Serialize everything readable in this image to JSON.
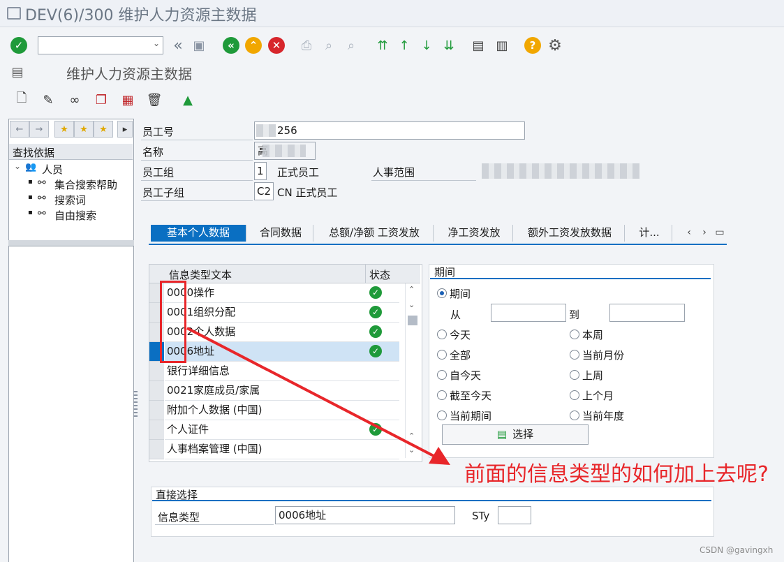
{
  "window": {
    "title": "DEV(6)/300 维护人力资源主数据"
  },
  "app": {
    "title": "维护人力资源主数据"
  },
  "toolbar": {
    "command_value": "",
    "icons": [
      "enter-check-icon",
      "back-double-chevron-icon",
      "save-icon",
      "back-icon",
      "exit-icon",
      "cancel-icon",
      "print-icon",
      "find-icon",
      "find-next-icon",
      "first-page-icon",
      "prev-page-icon",
      "next-page-icon",
      "last-page-icon",
      "new-session-icon",
      "shortcut-icon",
      "help-icon",
      "settings-icon"
    ]
  },
  "apptoolbar": {
    "icons": [
      "create-icon",
      "change-icon",
      "display-icon",
      "copy-icon",
      "delimit-icon",
      "delete-icon",
      "overview-icon"
    ]
  },
  "left": {
    "section_title": "查找依据",
    "tree_root": "人员",
    "tree_items": [
      "集合搜索帮助",
      "搜索词",
      "自由搜索"
    ]
  },
  "header": {
    "emp_no_label": "员工号",
    "emp_no_value": "256",
    "name_label": "名称",
    "name_value": "高",
    "group_label": "员工组",
    "group_code": "1",
    "group_text": "正式员工",
    "area_label": "人事范围",
    "subgroup_label": "员工子组",
    "subgroup_code": "C2",
    "subgroup_text": "CN 正式员工"
  },
  "tabs": [
    "基本个人数据",
    "合同数据",
    "总额/净额 工资发放",
    "净工资发放",
    "额外工资发放数据",
    "计..."
  ],
  "grid": {
    "col_text": "信息类型文本",
    "col_status": "状态",
    "rows": [
      {
        "text": "0000操作",
        "status": true
      },
      {
        "text": "0001组织分配",
        "status": true
      },
      {
        "text": "0002个人数据",
        "status": true
      },
      {
        "text": "0006地址",
        "status": true
      },
      {
        "text": "银行详细信息",
        "status": false
      },
      {
        "text": "0021家庭成员/家属",
        "status": false
      },
      {
        "text": "附加个人数据 (中国)",
        "status": false
      },
      {
        "text": "个人证件",
        "status": true
      },
      {
        "text": "人事档案管理 (中国)",
        "status": false
      }
    ]
  },
  "period": {
    "title": "期间",
    "opt_period": "期间",
    "from": "从",
    "to": "到",
    "options_left": [
      "今天",
      "全部",
      "自今天",
      "截至今天",
      "当前期间"
    ],
    "options_right": [
      "本周",
      "当前月份",
      "上周",
      "上个月",
      "当前年度"
    ],
    "select_btn": "选择"
  },
  "direct": {
    "title": "直接选择",
    "infotype_label": "信息类型",
    "infotype_value": "0006地址",
    "sty_label": "STy",
    "sty_value": ""
  },
  "annotation": "前面的信息类型的如何加上去呢?",
  "watermark": "CSDN @gavingxh",
  "colors": {
    "accent": "#0a6fc2",
    "annotation": "#e8262a",
    "status_ok": "#1f9a3a"
  }
}
